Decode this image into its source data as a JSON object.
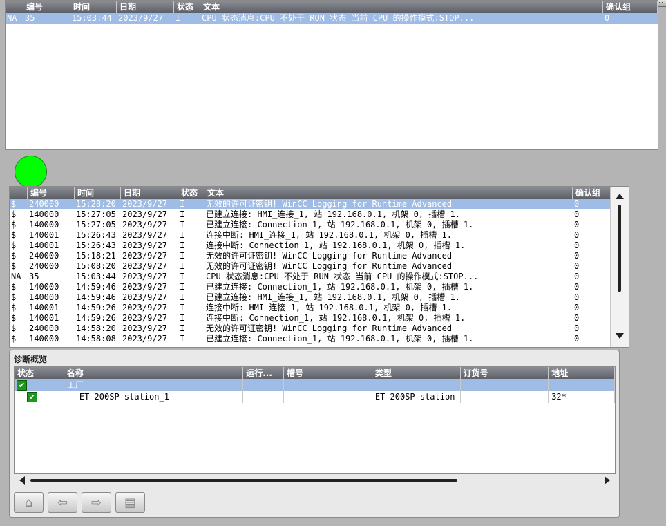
{
  "top_alarm": {
    "headers": [
      "",
      "编号",
      "时间",
      "日期",
      "状态",
      "文本",
      "确认组"
    ],
    "rows": [
      [
        "NA",
        "35",
        "15:03:44",
        "2023/9/27",
        "I",
        "CPU 状态消息:CPU 不处于 RUN 状态 当前 CPU 的操作模式:STOP...",
        "0"
      ]
    ]
  },
  "alarm_log": {
    "headers": [
      "",
      "编号",
      "时间",
      "日期",
      "状态",
      "文本",
      "确认组"
    ],
    "rows": [
      [
        "$",
        "240000",
        "15:28:20",
        "2023/9/27",
        "I",
        "无效的许可证密钥! WinCC Logging for Runtime Advanced",
        "0"
      ],
      [
        "$",
        "140000",
        "15:27:05",
        "2023/9/27",
        "I",
        "已建立连接: HMI_连接_1, 站 192.168.0.1, 机架 0, 插槽 1.",
        "0"
      ],
      [
        "$",
        "140000",
        "15:27:05",
        "2023/9/27",
        "I",
        "已建立连接: Connection_1, 站 192.168.0.1, 机架 0, 插槽 1.",
        "0"
      ],
      [
        "$",
        "140001",
        "15:26:43",
        "2023/9/27",
        "I",
        "连接中断: HMI_连接_1, 站 192.168.0.1, 机架 0, 插槽 1.",
        "0"
      ],
      [
        "$",
        "140001",
        "15:26:43",
        "2023/9/27",
        "I",
        "连接中断: Connection_1, 站 192.168.0.1, 机架 0, 插槽 1.",
        "0"
      ],
      [
        "$",
        "240000",
        "15:18:21",
        "2023/9/27",
        "I",
        "无效的许可证密钥! WinCC Logging for Runtime Advanced",
        "0"
      ],
      [
        "$",
        "240000",
        "15:08:20",
        "2023/9/27",
        "I",
        "无效的许可证密钥! WinCC Logging for Runtime Advanced",
        "0"
      ],
      [
        "NA",
        "35",
        "15:03:44",
        "2023/9/27",
        "I",
        "CPU 状态消息:CPU 不处于 RUN 状态 当前 CPU 的操作模式:STOP...",
        "0"
      ],
      [
        "$",
        "140000",
        "14:59:46",
        "2023/9/27",
        "I",
        "已建立连接: Connection_1, 站 192.168.0.1, 机架 0, 插槽 1.",
        "0"
      ],
      [
        "$",
        "140000",
        "14:59:46",
        "2023/9/27",
        "I",
        "已建立连接: HMI_连接_1, 站 192.168.0.1, 机架 0, 插槽 1.",
        "0"
      ],
      [
        "$",
        "140001",
        "14:59:26",
        "2023/9/27",
        "I",
        "连接中断: HMI_连接_1, 站 192.168.0.1, 机架 0, 插槽 1.",
        "0"
      ],
      [
        "$",
        "140001",
        "14:59:26",
        "2023/9/27",
        "I",
        "连接中断: Connection_1, 站 192.168.0.1, 机架 0, 插槽 1.",
        "0"
      ],
      [
        "$",
        "240000",
        "14:58:20",
        "2023/9/27",
        "I",
        "无效的许可证密钥! WinCC Logging for Runtime Advanced",
        "0"
      ],
      [
        "$",
        "140000",
        "14:58:08",
        "2023/9/27",
        "I",
        "已建立连接: Connection_1, 站 192.168.0.1, 机架 0, 插槽 1.",
        "0"
      ]
    ]
  },
  "diagnostics": {
    "title": "诊断概览",
    "headers": [
      "状态",
      "名称",
      "运行...",
      "槽号",
      "类型",
      "订货号",
      "地址"
    ],
    "rows": [
      {
        "status": "ok",
        "name": "工厂",
        "run": "",
        "slot": "",
        "type": "",
        "order": "",
        "address": ""
      },
      {
        "status": "ok",
        "name": "ET 200SP station_1",
        "run": "",
        "slot": "",
        "type": "ET 200SP station",
        "order": "",
        "address": "32*"
      }
    ],
    "check_glyph": "✔"
  },
  "nav": {
    "home_icon": "⌂",
    "back_icon": "⇦",
    "forward_icon": "⇨",
    "detail_icon": "▤"
  },
  "colors": {
    "selection": "#9fbce6",
    "indicator": "#00ff00",
    "status_ok": "#1a9a1a"
  }
}
